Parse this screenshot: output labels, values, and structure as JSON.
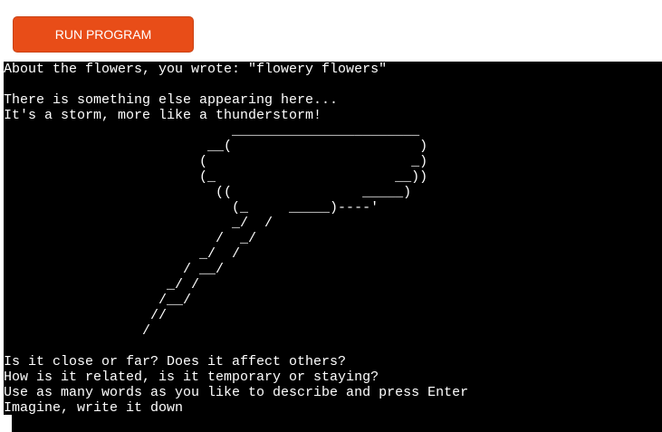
{
  "toolbar": {
    "run_label": "RUN PROGRAM",
    "accent_color": "#e84d18"
  },
  "terminal": {
    "output": "About the flowers, you wrote: \"flowery flowers\"\n\nThere is something else appearing here...\nIt's a storm, more like a thunderstorm!\n                            _______________________\n                         __(                       )\n                        (                         _)\n                        (_                      __))\n                          ((                _____)\n                            (_     _____)----'\n                            _/  /\n                          /  _/\n                        _/  /\n                      / __/\n                    _/ /\n                   /__/\n                  //\n                 /\n\nIs it close or far? Does it affect others?\nHow is it related, is it temporary or staying?\nUse as many words as you like to describe and press Enter\nImagine, write it down",
    "background_color": "#000000",
    "text_color": "#ffffff"
  }
}
